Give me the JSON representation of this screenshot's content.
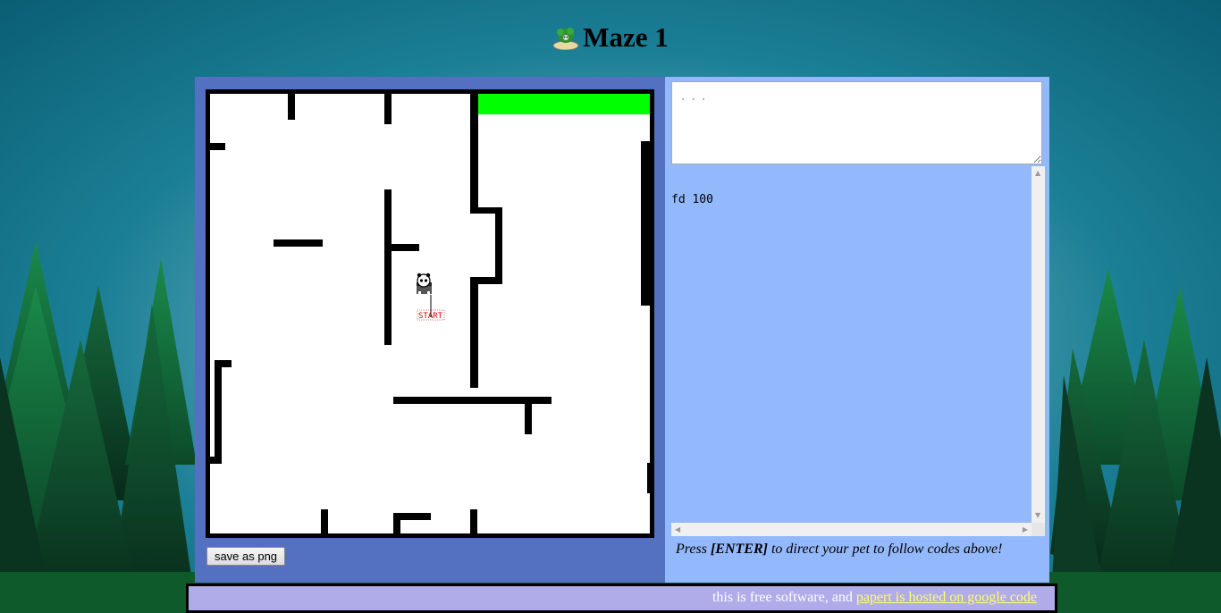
{
  "page": {
    "title": "Maze 1",
    "logo_icon": "pet-island-icon"
  },
  "maze": {
    "start_label": "START",
    "goal_color": "#00ff00",
    "wall_color": "#000000",
    "turtle_icon": "panda-turtle-icon"
  },
  "controls": {
    "save_label": "save as png"
  },
  "editor": {
    "placeholder": "...",
    "log_lines": [
      "fd 100"
    ]
  },
  "hint": {
    "before": "Press ",
    "key": "[ENTER]",
    "after": " to direct your pet to follow codes above!"
  },
  "footer": {
    "text": "this is free software, and ",
    "link_text": "papert is hosted on google code"
  },
  "colors": {
    "left_panel": "#5470c0",
    "right_panel": "#94b8fc",
    "footer_bg": "#b0acea",
    "link": "#ffff66"
  }
}
